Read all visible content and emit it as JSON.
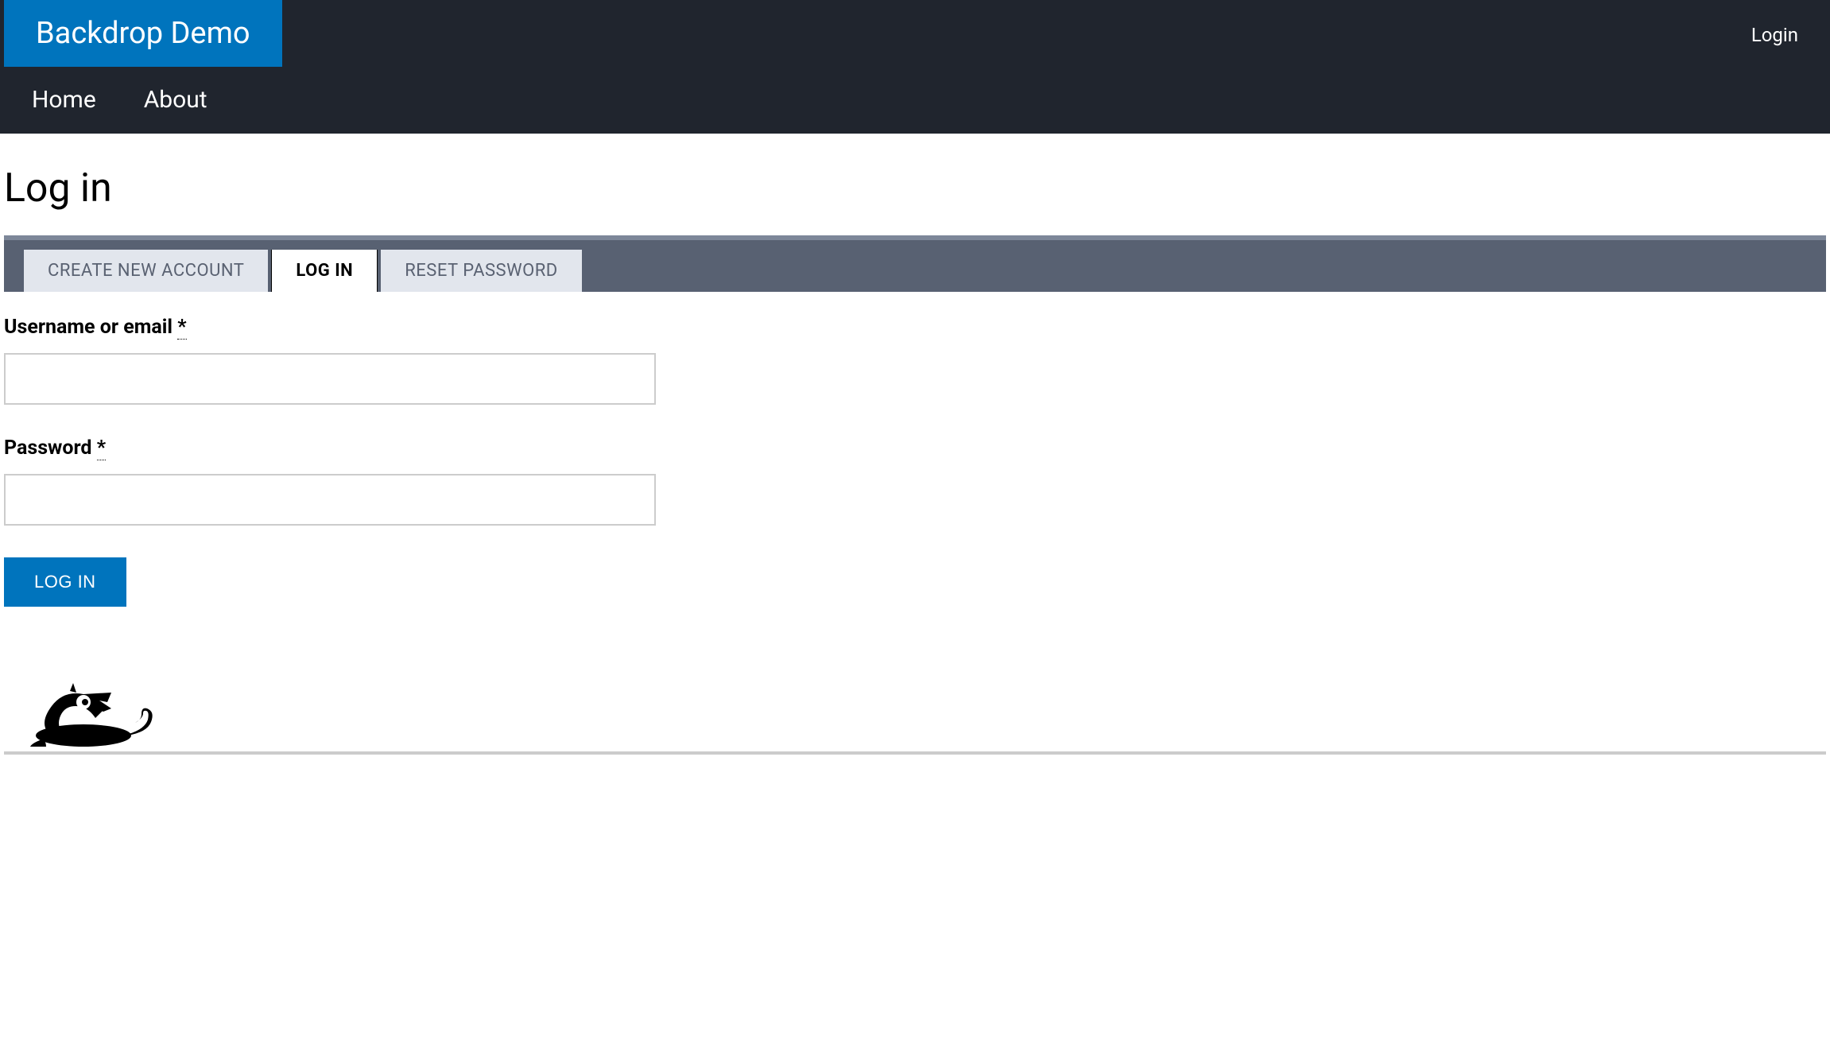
{
  "header": {
    "site_title": "Backdrop Demo",
    "login_link": "Login",
    "nav": [
      {
        "label": "Home"
      },
      {
        "label": "About"
      }
    ]
  },
  "page": {
    "title": "Log in"
  },
  "tabs": [
    {
      "label": "CREATE NEW ACCOUNT",
      "active": false
    },
    {
      "label": "LOG IN",
      "active": true
    },
    {
      "label": "RESET PASSWORD",
      "active": false
    }
  ],
  "form": {
    "username": {
      "label": "Username or email ",
      "required": "*",
      "value": ""
    },
    "password": {
      "label": "Password ",
      "required": "*",
      "value": ""
    },
    "submit_label": "LOG IN"
  }
}
